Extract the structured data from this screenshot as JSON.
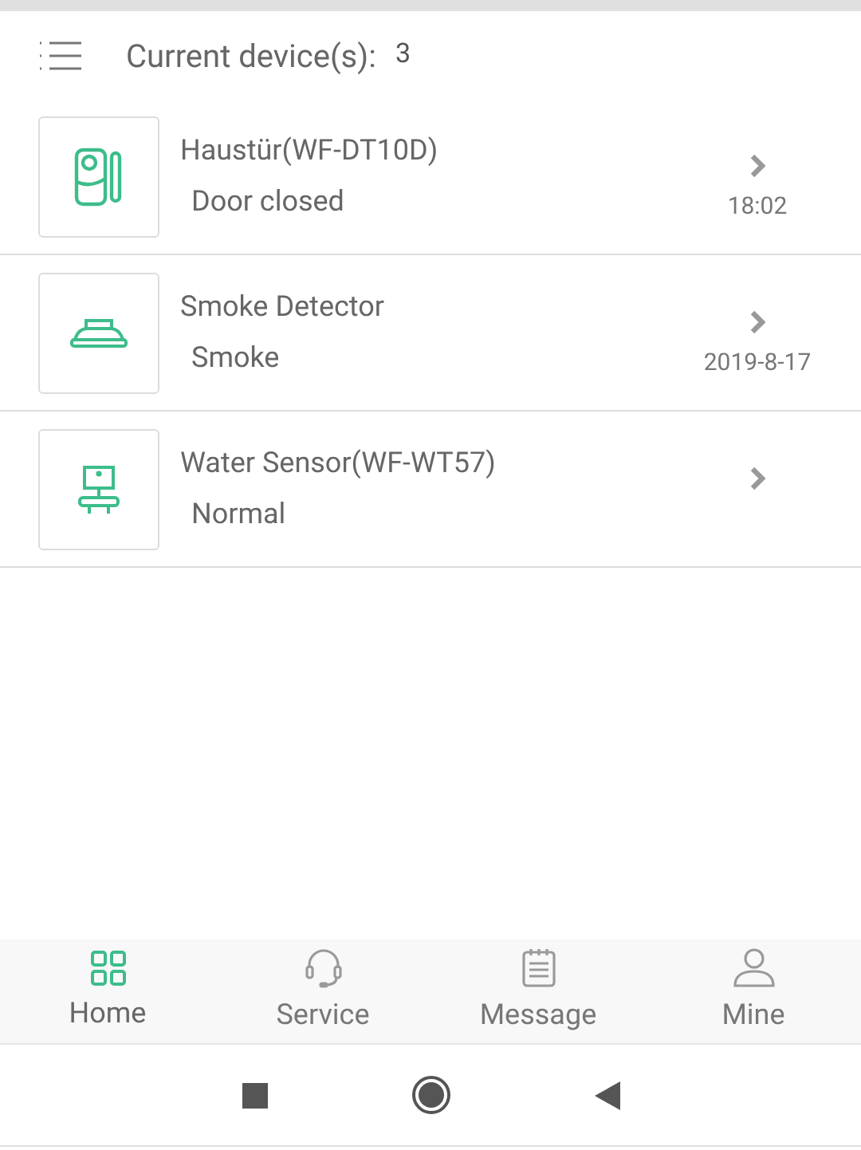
{
  "header": {
    "label": "Current device(s):",
    "count": "3"
  },
  "devices": [
    {
      "kind": "door",
      "name": "Haustür(WF-DT10D)",
      "status": "Door closed",
      "time": "18:02"
    },
    {
      "kind": "smoke",
      "name": "Smoke Detector",
      "status": "Smoke",
      "time": "2019-8-17"
    },
    {
      "kind": "water",
      "name": "Water Sensor(WF-WT57)",
      "status": "Normal"
    }
  ],
  "tabs": [
    {
      "kind": "home",
      "label": "Home",
      "selected": true
    },
    {
      "kind": "service",
      "label": "Service",
      "selected": false
    },
    {
      "kind": "message",
      "label": "Message",
      "selected": false
    },
    {
      "kind": "mine",
      "label": "Mine",
      "selected": false
    }
  ]
}
